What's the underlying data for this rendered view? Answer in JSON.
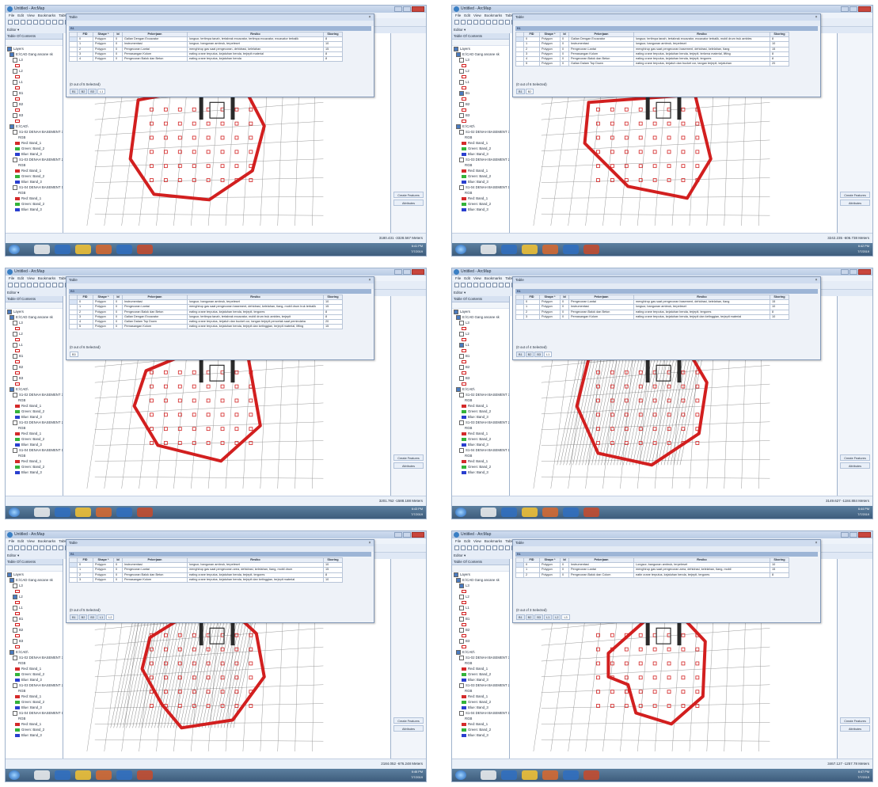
{
  "colors": {
    "accent_red": "#d21f1f",
    "titlebar": "#cfdcef",
    "taskbar": "#4b6d8e",
    "selection": "#9db5d6"
  },
  "app": {
    "title": "Untitled - ArcMap",
    "menus": [
      "File",
      "Edit",
      "View",
      "Bookmarks",
      "Table"
    ],
    "editor_label": "Editor ▾",
    "toc_title": "Table Of Contents",
    "table_caption": "Table",
    "right_buttons": [
      "Create Features",
      "Attributes"
    ]
  },
  "attr_columns": [
    "FID",
    "Shape *",
    "Id",
    "Pekerjaan",
    "Resiko",
    "Skoring"
  ],
  "layers": {
    "root": "Layers",
    "group": "E:\\CAD Gang ancane sk",
    "items": [
      "L3",
      "L2",
      "L1",
      "B1",
      "B2",
      "B3"
    ],
    "cad_group": "E:\\CAD\\",
    "rasters": [
      "S1-02 DENAH BASEMENT 3",
      "S1-03 DENAH BASEMENT 2",
      "S1-04 DENAH BASEMENT 1"
    ],
    "rgb": "RGB",
    "bands": [
      "Red: Band_1",
      "Green: Band_2",
      "Blue: Band_3"
    ]
  },
  "panels": [
    {
      "rows": [
        [
          "0",
          "Polygon",
          "0",
          "Galian Dengan Excavator",
          "longsor, tertimpa tanah, tertabrak excavator, tertimpa excavator, excavator terbalik",
          "8"
        ],
        [
          "1",
          "Polygon",
          "0",
          "Instrumentasi",
          "longsor, bangunan ambruk, terpeleset",
          "10"
        ],
        [
          "2",
          "Polygon",
          "0",
          "Pengecoran Lantai",
          "menghirup gas saat pengecoran, dehidrasi, kelelahan",
          "15"
        ],
        [
          "3",
          "Polygon",
          "0",
          "Pemasangan Kolom",
          "eating crane terputus, kejatuhan benda, terjepit material",
          "8"
        ],
        [
          "4",
          "Polygon",
          "0",
          "Pengecoran Balok dan Beton",
          "eating crane terputus, kejatuhan benda",
          "8"
        ]
      ],
      "nav_text": "(0 out of 5 Selected)",
      "tabs": [
        "B1",
        "B2",
        "B3",
        "L1"
      ],
      "coords": "3180.431 -3328.567 Meters",
      "clock": [
        "6:41 PM",
        "7/7/2019"
      ]
    },
    {
      "rows": [
        [
          "0",
          "Polygon",
          "0",
          "Galian Dengan Excavator",
          "longsor, tertimpa tanah, tertabrak excavator, excavator terbalik, mobil drum truk ambles",
          "8"
        ],
        [
          "1",
          "Polygon",
          "0",
          "Instrumentasi",
          "longsor, bangunan ambruk, terpeleset",
          "10"
        ],
        [
          "2",
          "Polygon",
          "0",
          "Pengecoran Lantai",
          "menghirup gas saat pengecoran basement, dehidrasi, kelelahan, tiang",
          "15"
        ],
        [
          "3",
          "Polygon",
          "0",
          "Pemasangan Kolom",
          "eating crane terputus, kejatuhan benda, terjepit, terkena material, lifting",
          "8"
        ],
        [
          "4",
          "Polygon",
          "0",
          "Pengecoran Balok dan Beton",
          "eating crane terputus, kejatuhan benda, terjepit, tergores",
          "8"
        ],
        [
          "5",
          "Polygon",
          "0",
          "Galian Dalam Top Down",
          "eating crane terputus, terjatuh dan bucket cor, tangan terjepit, kejatuhan",
          "20"
        ]
      ],
      "nav_text": "(0 out of 6 Selected)",
      "tabs": [
        "B1",
        "B2"
      ],
      "coords": "3242.235 -606.738 Meters",
      "clock": [
        "6:42 PM",
        "7/7/2019"
      ]
    },
    {
      "rows": [
        [
          "0",
          "Polygon",
          "0",
          "Instrumentasi",
          "longsor, bangunan ambruk, terpeleset",
          "10"
        ],
        [
          "1",
          "Polygon",
          "0",
          "Pengecoran Lantai",
          "menghirup gas saat pengecoran basement, dehidrasi, kelelahan, tiang, mobil drum truk terbalik",
          "15"
        ],
        [
          "2",
          "Polygon",
          "0",
          "Pengecoran Balok dan Beton",
          "eating crane terputus, kejatuhan benda, terjepit, tergores",
          "8"
        ],
        [
          "3",
          "Polygon",
          "0",
          "Galian Dengan Excavator",
          "longsor, tertimpa tanah, tertabrak excavator, mobil drum truk ambles, terjepit",
          "8"
        ],
        [
          "4",
          "Polygon",
          "0",
          "Galian Dalam Top Down",
          "eating crane terputus, terjatuh dan bucket cor, tangan terjepit pencetak saat pemindaha",
          "20"
        ],
        [
          "5",
          "Polygon",
          "0",
          "Pemasangan Kolom",
          "eating crane terputus, kejatuhan benda, terjepit dan ketinggian, terjepit material, lifting",
          "15"
        ]
      ],
      "nav_text": "(0 out of 6 Selected)",
      "tabs": [
        "B3"
      ],
      "coords": "3201.762 -1588.188 Meters",
      "clock": [
        "6:43 PM",
        "7/7/2019"
      ]
    },
    {
      "rows": [
        [
          "0",
          "Polygon",
          "0",
          "Pengecoran Lantai",
          "menghirup gas saat pengecoran basement, dehidrasi, kelelahan, tiang",
          "15"
        ],
        [
          "1",
          "Polygon",
          "0",
          "Instrumentasi",
          "longsor, bangunan ambruk, terpeleset",
          "10"
        ],
        [
          "2",
          "Polygon",
          "0",
          "Pengecoran Balok dan Beton",
          "eating crane terputus, kejatuhan benda, terjepit, tergores",
          "8"
        ],
        [
          "3",
          "Polygon",
          "0",
          "Pemasangan Kolom",
          "eating crane terputus, kejatuhan benda, terjepit dan ketinggian, terjepit material",
          "10"
        ]
      ],
      "nav_text": "(0 out of 4 Selected)",
      "tabs": [
        "B1",
        "B2",
        "B3",
        "L1"
      ],
      "coords": "3149.627 -1184.884 Meters",
      "clock": [
        "6:44 PM",
        "7/7/2019"
      ]
    },
    {
      "rows": [
        [
          "0",
          "Polygon",
          "0",
          "Instrumentasi",
          "longsor, bangunan ambruk, terpeleset",
          "10"
        ],
        [
          "1",
          "Polygon",
          "0",
          "Pengecoran Lantai",
          "menghirup gas saat pengecoran area, dehidrasi, kelelahan, tiang, mobil drum",
          "15"
        ],
        [
          "2",
          "Polygon",
          "0",
          "Pengecoran Balok dan Beton",
          "eating crane terputus, kejatuhan benda, terjepit, tergores",
          "8"
        ],
        [
          "3",
          "Polygon",
          "0",
          "Pemasangan Kolom",
          "eating crane terputus, kejatuhan benda, terjepit dan ketinggian, terjepit material",
          "10"
        ]
      ],
      "nav_text": "(0 out of 5 Selected)",
      "tabs": [
        "B1",
        "B2",
        "B3",
        "L1",
        "L2"
      ],
      "coords": "2184.052 -676.248 Meters",
      "clock": [
        "6:46 PM",
        "7/7/2019"
      ]
    },
    {
      "rows": [
        [
          "0",
          "Polygon",
          "0",
          "Instrumentasi",
          "Longsor, bangunan ambruk, terpeleset",
          "10"
        ],
        [
          "1",
          "Polygon",
          "0",
          "Pengecoran Lantai",
          "menghirup gas saat pengecoran area, dehidrasi, kelelahan, tiang, mobil",
          "15"
        ],
        [
          "2",
          "Polygon",
          "0",
          "Pengecoran Balok dan Colom",
          "eatin crane terputus, kejatuhan benda, terjepit, tergores",
          "8"
        ]
      ],
      "nav_text": "(0 out of 3 Selected)",
      "tabs": [
        "B1",
        "B2",
        "B3",
        "L1",
        "L2",
        "L3"
      ],
      "coords": "3467.127 -1257.78 Meters",
      "clock": [
        "6:47 PM",
        "7/7/2019"
      ]
    }
  ]
}
